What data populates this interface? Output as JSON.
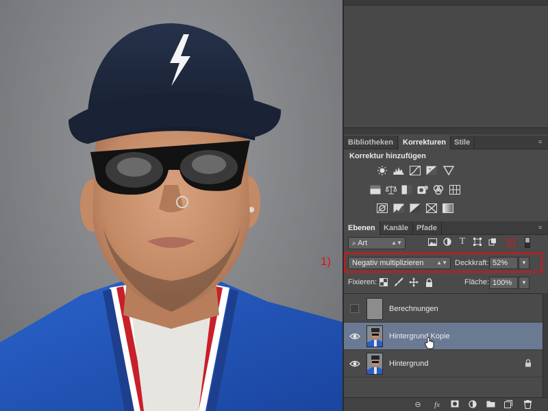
{
  "tabs_korrekturen": {
    "items": [
      {
        "label": "Bibliotheken",
        "active": false
      },
      {
        "label": "Korrekturen",
        "active": true
      },
      {
        "label": "Stile",
        "active": false
      }
    ]
  },
  "korrekturen": {
    "title": "Korrektur hinzufügen",
    "row1": [
      "brightness-icon",
      "levels-icon",
      "curves-icon",
      "exposure-icon",
      "gradient-triangle-icon"
    ],
    "row2": [
      "vibrance-icon",
      "color-balance-icon",
      "bw-icon",
      "photo-filter-icon",
      "channel-mixer-icon",
      "color-lookup-icon"
    ],
    "row3": [
      "invert-icon",
      "posterize-icon",
      "threshold-icon",
      "selective-color-icon",
      "gradient-map-icon"
    ]
  },
  "tabs_ebenen": {
    "items": [
      {
        "label": "Ebenen",
        "active": true
      },
      {
        "label": "Kanäle",
        "active": false
      },
      {
        "label": "Pfade",
        "active": false
      }
    ]
  },
  "filter": {
    "kind_label": "Art"
  },
  "blend": {
    "mode": "Negativ multiplizieren",
    "opacity_label": "Deckkraft:",
    "opacity_value": "52%"
  },
  "lock": {
    "label": "Fixieren:",
    "fill_label": "Fläche:",
    "fill_value": "100%"
  },
  "layers": [
    {
      "name": "Berechnungen",
      "visible": false,
      "selected": false,
      "locked": false
    },
    {
      "name": "Hintergrund Kopie",
      "visible": true,
      "selected": true,
      "locked": false
    },
    {
      "name": "Hintergrund",
      "visible": true,
      "selected": false,
      "locked": true
    }
  ],
  "annotations": {
    "label_1": "1)",
    "label_2": "2)",
    "color": "#e01010"
  },
  "colors": {
    "panel_bg": "#4a4a4a",
    "selected_layer": "#6a7a92"
  }
}
